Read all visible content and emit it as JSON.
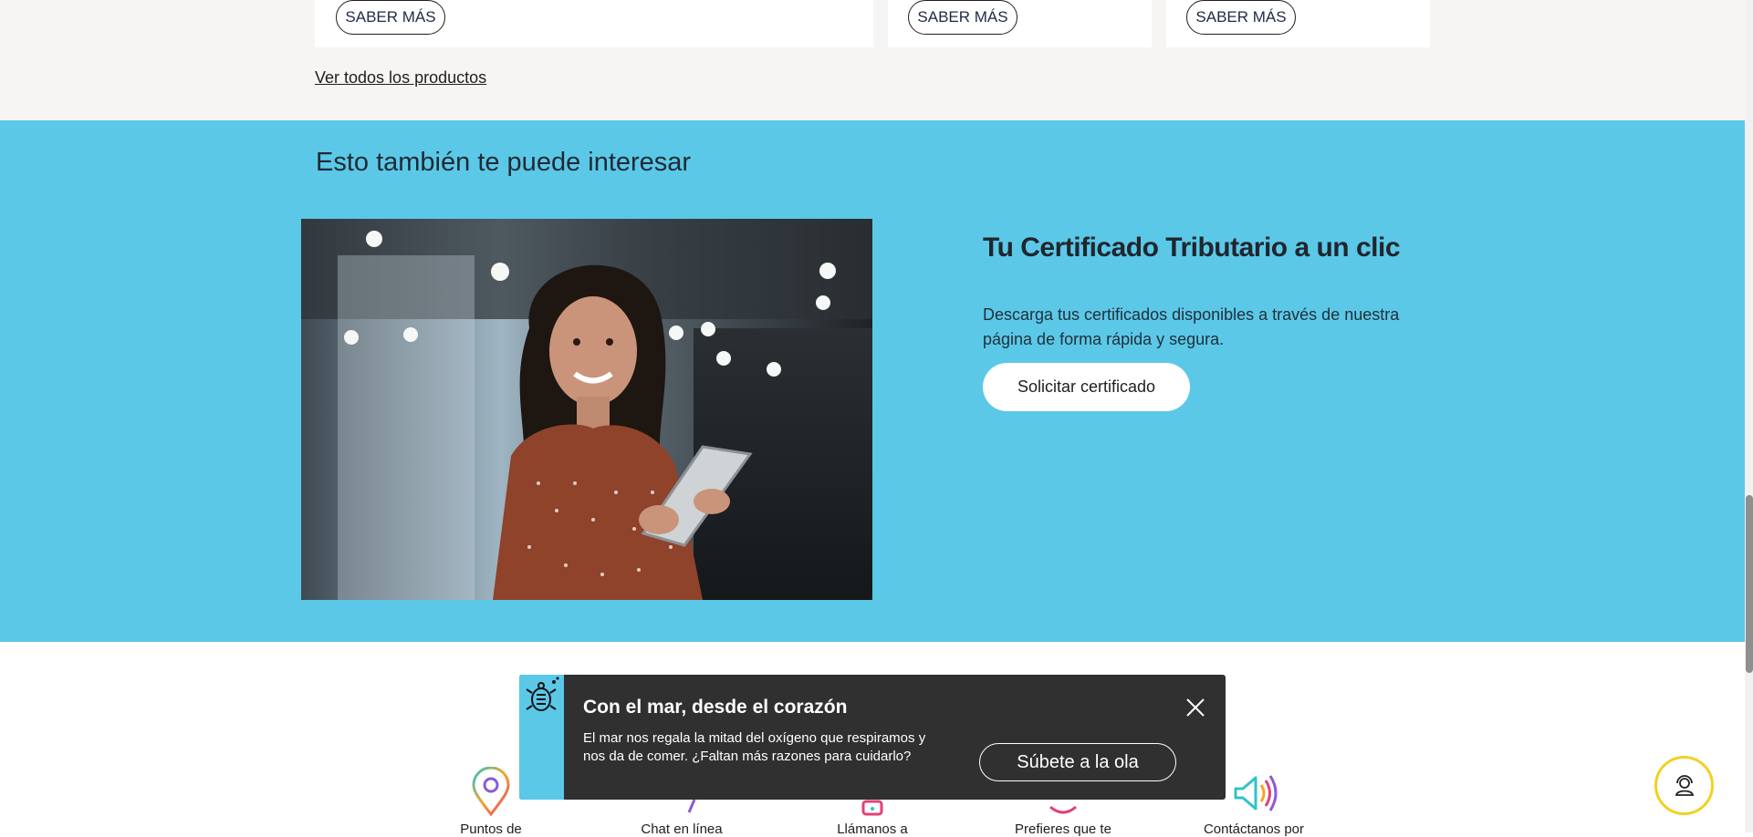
{
  "products": {
    "cards": [
      {
        "button_label": "SABER MÁS"
      },
      {
        "button_label": "SABER MÁS"
      },
      {
        "button_label": "SABER MÁS"
      }
    ],
    "view_all_link": "Ver todos los productos"
  },
  "interest": {
    "section_title": "Esto también te puede interesar",
    "promo_title": "Tu Certificado Tributario a un clic",
    "promo_description": "Descarga tus certificados disponibles a través de nuestra página de forma rápida y segura.",
    "cta_label": "Solicitar certificado",
    "image_icon": "photo-woman-with-tablet"
  },
  "contact": {
    "items": [
      {
        "label": "Puntos de",
        "icon": "location-pin-icon"
      },
      {
        "label": "Chat en línea",
        "icon": "chat-icon"
      },
      {
        "label": "Llámanos a",
        "icon": "phone-icon"
      },
      {
        "label": "Prefieres que te",
        "icon": "callback-icon"
      },
      {
        "label": "Contáctanos por",
        "icon": "megaphone-icon"
      }
    ]
  },
  "popup": {
    "title": "Con el mar, desde el corazón",
    "description": "El mar nos regala la mitad del oxígeno que respiramos y nos da de comer. ¿Faltan más razones para cuidarlo?",
    "cta_label": "Súbete a la ola",
    "icon": "turtle-icon"
  },
  "help": {
    "icon": "support-agent-icon"
  },
  "colors": {
    "section_gray": "#f6f5f4",
    "section_blue": "#5bc8e8",
    "popup_bg": "#303030",
    "help_ring": "#f2d120"
  }
}
